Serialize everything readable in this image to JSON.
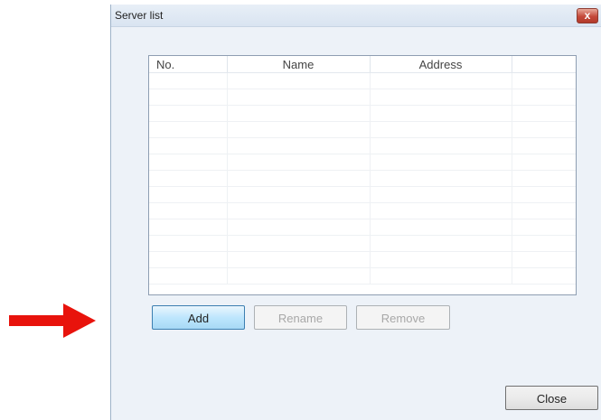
{
  "dialog": {
    "title": "Server list",
    "close_glyph": "x"
  },
  "table": {
    "columns": [
      "No.",
      "Name",
      "Address",
      ""
    ],
    "rows": []
  },
  "buttons": {
    "add": "Add",
    "rename": "Rename",
    "remove": "Remove",
    "close": "Close"
  },
  "colors": {
    "annotation_arrow": "#e8130c",
    "dialog_bg": "#edf2f8",
    "add_button_accent": "#bee6fd"
  },
  "icons": {
    "arrow": "red-arrow-icon",
    "close": "close-icon"
  }
}
